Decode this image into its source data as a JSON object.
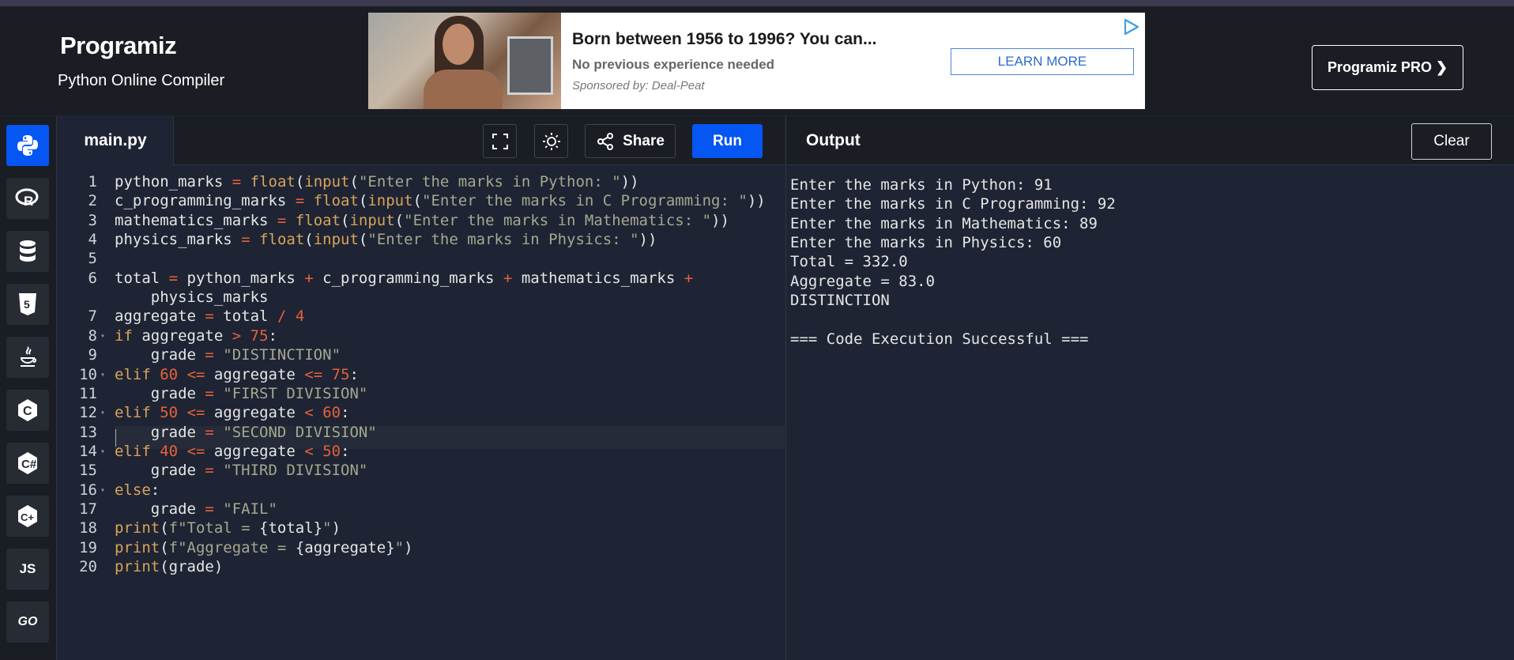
{
  "header": {
    "logo": "Programiz",
    "subtitle": "Python Online Compiler",
    "pro_button": "Programiz PRO ❯"
  },
  "ad": {
    "title": "Born between 1956 to 1996? You can...",
    "subtitle": "No previous experience needed",
    "sponsor": "Sponsored by: Deal-Peat",
    "cta": "LEARN MORE"
  },
  "sidebar": {
    "items": [
      {
        "name": "python",
        "label": ""
      },
      {
        "name": "r",
        "label": "R"
      },
      {
        "name": "sql",
        "label": ""
      },
      {
        "name": "html",
        "label": "5"
      },
      {
        "name": "java",
        "label": ""
      },
      {
        "name": "c",
        "label": "C"
      },
      {
        "name": "csharp",
        "label": "C#"
      },
      {
        "name": "cpp",
        "label": "C++"
      },
      {
        "name": "js",
        "label": "JS"
      },
      {
        "name": "go",
        "label": "GO"
      }
    ]
  },
  "editor": {
    "tab": "main.py",
    "share_label": "Share",
    "run_label": "Run",
    "lines": [
      {
        "n": "1",
        "fold": "",
        "tokens": [
          [
            "v",
            "python_marks "
          ],
          [
            "o",
            "="
          ],
          [
            "v",
            " "
          ],
          [
            "k",
            "float"
          ],
          [
            "v",
            "("
          ],
          [
            "k",
            "input"
          ],
          [
            "v",
            "("
          ],
          [
            "s",
            "\"Enter the marks in Python: \""
          ],
          [
            "v",
            "))"
          ]
        ]
      },
      {
        "n": "2",
        "fold": "",
        "tokens": [
          [
            "v",
            "c_programming_marks "
          ],
          [
            "o",
            "="
          ],
          [
            "v",
            " "
          ],
          [
            "k",
            "float"
          ],
          [
            "v",
            "("
          ],
          [
            "k",
            "input"
          ],
          [
            "v",
            "("
          ],
          [
            "s",
            "\"Enter the marks in C Programming: \""
          ],
          [
            "v",
            "))"
          ]
        ]
      },
      {
        "n": "3",
        "fold": "",
        "tokens": [
          [
            "v",
            "mathematics_marks "
          ],
          [
            "o",
            "="
          ],
          [
            "v",
            " "
          ],
          [
            "k",
            "float"
          ],
          [
            "v",
            "("
          ],
          [
            "k",
            "input"
          ],
          [
            "v",
            "("
          ],
          [
            "s",
            "\"Enter the marks in Mathematics: \""
          ],
          [
            "v",
            "))"
          ]
        ]
      },
      {
        "n": "4",
        "fold": "",
        "tokens": [
          [
            "v",
            "physics_marks "
          ],
          [
            "o",
            "="
          ],
          [
            "v",
            " "
          ],
          [
            "k",
            "float"
          ],
          [
            "v",
            "("
          ],
          [
            "k",
            "input"
          ],
          [
            "v",
            "("
          ],
          [
            "s",
            "\"Enter the marks in Physics: \""
          ],
          [
            "v",
            "))"
          ]
        ]
      },
      {
        "n": "5",
        "fold": "",
        "tokens": []
      },
      {
        "n": "6",
        "fold": "",
        "tokens": [
          [
            "v",
            "total "
          ],
          [
            "o",
            "="
          ],
          [
            "v",
            " python_marks "
          ],
          [
            "o",
            "+"
          ],
          [
            "v",
            " c_programming_marks "
          ],
          [
            "o",
            "+"
          ],
          [
            "v",
            " mathematics_marks "
          ],
          [
            "o",
            "+"
          ]
        ]
      },
      {
        "n": "",
        "fold": "",
        "tokens": [
          [
            "v",
            "    physics_marks"
          ]
        ]
      },
      {
        "n": "7",
        "fold": "",
        "tokens": [
          [
            "v",
            "aggregate "
          ],
          [
            "o",
            "="
          ],
          [
            "v",
            " total "
          ],
          [
            "o",
            "/"
          ],
          [
            "v",
            " "
          ],
          [
            "n",
            "4"
          ]
        ]
      },
      {
        "n": "8",
        "fold": "▾",
        "tokens": [
          [
            "k",
            "if"
          ],
          [
            "v",
            " aggregate "
          ],
          [
            "o",
            ">"
          ],
          [
            "v",
            " "
          ],
          [
            "n",
            "75"
          ],
          [
            "v",
            ":"
          ]
        ]
      },
      {
        "n": "9",
        "fold": "",
        "tokens": [
          [
            "v",
            "    grade "
          ],
          [
            "o",
            "="
          ],
          [
            "v",
            " "
          ],
          [
            "s",
            "\"DISTINCTION\""
          ]
        ]
      },
      {
        "n": "10",
        "fold": "▾",
        "tokens": [
          [
            "k",
            "elif"
          ],
          [
            "v",
            " "
          ],
          [
            "n",
            "60"
          ],
          [
            "v",
            " "
          ],
          [
            "o",
            "<="
          ],
          [
            "v",
            " aggregate "
          ],
          [
            "o",
            "<="
          ],
          [
            "v",
            " "
          ],
          [
            "n",
            "75"
          ],
          [
            "v",
            ":"
          ]
        ]
      },
      {
        "n": "11",
        "fold": "",
        "tokens": [
          [
            "v",
            "    grade "
          ],
          [
            "o",
            "="
          ],
          [
            "v",
            " "
          ],
          [
            "s",
            "\"FIRST DIVISION\""
          ]
        ]
      },
      {
        "n": "12",
        "fold": "▾",
        "tokens": [
          [
            "k",
            "elif"
          ],
          [
            "v",
            " "
          ],
          [
            "n",
            "50"
          ],
          [
            "v",
            " "
          ],
          [
            "o",
            "<="
          ],
          [
            "v",
            " aggregate "
          ],
          [
            "o",
            "<"
          ],
          [
            "v",
            " "
          ],
          [
            "n",
            "60"
          ],
          [
            "v",
            ":"
          ]
        ]
      },
      {
        "n": "13",
        "fold": "",
        "tokens": [
          [
            "v",
            "    grade "
          ],
          [
            "o",
            "="
          ],
          [
            "v",
            " "
          ],
          [
            "s",
            "\"SECOND DIVISION\""
          ]
        ]
      },
      {
        "n": "14",
        "fold": "▾",
        "tokens": [
          [
            "k",
            "elif"
          ],
          [
            "v",
            " "
          ],
          [
            "n",
            "40"
          ],
          [
            "v",
            " "
          ],
          [
            "o",
            "<="
          ],
          [
            "v",
            " aggregate "
          ],
          [
            "o",
            "<"
          ],
          [
            "v",
            " "
          ],
          [
            "n",
            "50"
          ],
          [
            "v",
            ":"
          ]
        ]
      },
      {
        "n": "15",
        "fold": "",
        "tokens": [
          [
            "v",
            "    grade "
          ],
          [
            "o",
            "="
          ],
          [
            "v",
            " "
          ],
          [
            "s",
            "\"THIRD DIVISION\""
          ]
        ]
      },
      {
        "n": "16",
        "fold": "▾",
        "tokens": [
          [
            "k",
            "else"
          ],
          [
            "v",
            ":"
          ]
        ]
      },
      {
        "n": "17",
        "fold": "",
        "tokens": [
          [
            "v",
            "    grade "
          ],
          [
            "o",
            "="
          ],
          [
            "v",
            " "
          ],
          [
            "s",
            "\"FAIL\""
          ]
        ]
      },
      {
        "n": "18",
        "fold": "",
        "tokens": [
          [
            "k",
            "print"
          ],
          [
            "v",
            "("
          ],
          [
            "s",
            "f\"Total = "
          ],
          [
            "v",
            "{total}"
          ],
          [
            "s",
            "\""
          ],
          [
            "v",
            ")"
          ]
        ]
      },
      {
        "n": "19",
        "fold": "",
        "tokens": [
          [
            "k",
            "print"
          ],
          [
            "v",
            "("
          ],
          [
            "s",
            "f\"Aggregate = "
          ],
          [
            "v",
            "{aggregate}"
          ],
          [
            "s",
            "\""
          ],
          [
            "v",
            ")"
          ]
        ]
      },
      {
        "n": "20",
        "fold": "",
        "tokens": [
          [
            "k",
            "print"
          ],
          [
            "v",
            "(grade)"
          ]
        ]
      }
    ]
  },
  "output": {
    "title": "Output",
    "clear_label": "Clear",
    "lines": [
      "Enter the marks in Python: 91",
      "Enter the marks in C Programming: 92",
      "Enter the marks in Mathematics: 89",
      "Enter the marks in Physics: 60",
      "Total = 332.0",
      "Aggregate = 83.0",
      "DISTINCTION",
      "",
      "=== Code Execution Successful ==="
    ]
  }
}
